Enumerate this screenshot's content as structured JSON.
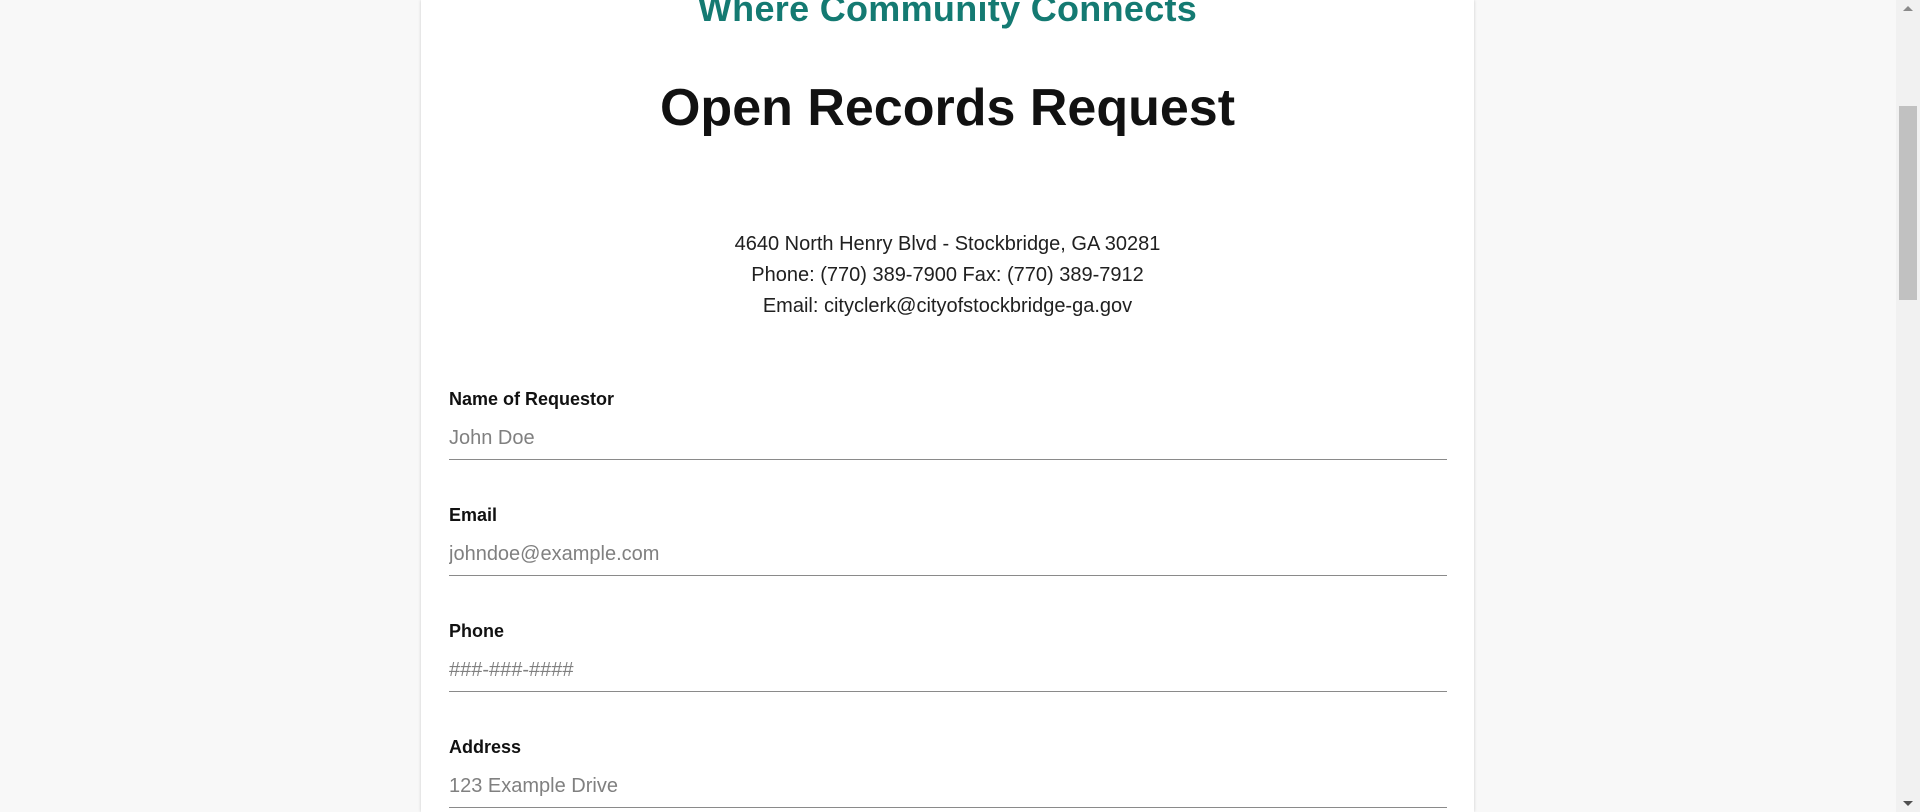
{
  "header": {
    "tagline": "Where Community Connects",
    "title": "Open Records Request"
  },
  "contact": {
    "address": "4640 North Henry Blvd - Stockbridge, GA 30281",
    "phone_fax": "Phone: (770) 389-7900 Fax: (770) 389-7912",
    "email": "Email: cityclerk@cityofstockbridge-ga.gov"
  },
  "form": {
    "fields": [
      {
        "label": "Name of Requestor",
        "placeholder": "John Doe",
        "value": ""
      },
      {
        "label": "Email",
        "placeholder": "johndoe@example.com",
        "value": ""
      },
      {
        "label": "Phone",
        "placeholder": "###-###-####",
        "value": ""
      },
      {
        "label": "Address",
        "placeholder": "123 Example Drive",
        "value": ""
      }
    ]
  },
  "colors": {
    "tagline": "#147a72",
    "background": "#f8f8f8",
    "card": "#ffffff"
  }
}
